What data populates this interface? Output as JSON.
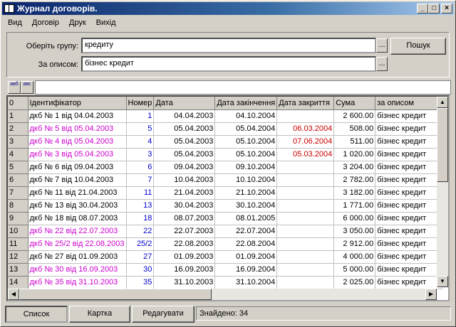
{
  "title": "Журнал договорів.",
  "menu": [
    "Вид",
    "Договір",
    "Друк",
    "Вихід"
  ],
  "filters": {
    "group_label": "Оберіть групу:",
    "group_value": "кредиту",
    "desc_label": "За описом:",
    "desc_value": "бізнес кредит",
    "dots": "...",
    "search_label": "Пошук"
  },
  "toolbar": {
    "sort_icon_text": "авб",
    "filter_icon_text": "авс"
  },
  "columns": [
    "0",
    "Ідентифікатор",
    "Номер",
    "Дата",
    "Дата закінчення",
    "Дата закриття",
    "Сума",
    "за описом"
  ],
  "colors": {
    "pink": "#cc00cc",
    "blue": "#0000cc",
    "red": "#cc0000"
  },
  "rows": [
    {
      "n": "1",
      "id": "дкб № 1 від 04.04.2003",
      "num": "1",
      "date": "04.04.2003",
      "end": "04.10.2004",
      "closed": "",
      "sum": "2 600.00",
      "desc": "бізнес кредит",
      "pink": false
    },
    {
      "n": "2",
      "id": "дкб № 5 від 05.04.2003",
      "num": "5",
      "date": "05.04.2003",
      "end": "05.04.2004",
      "closed": "06.03.2004",
      "sum": "508.00",
      "desc": "бізнес кредит",
      "pink": true
    },
    {
      "n": "3",
      "id": "дкб № 4 від 05.04.2003",
      "num": "4",
      "date": "05.04.2003",
      "end": "05.10.2004",
      "closed": "07.06.2004",
      "sum": "511.00",
      "desc": "бізнес кредит",
      "pink": true
    },
    {
      "n": "4",
      "id": "дкб № 3 від 05.04.2003",
      "num": "3",
      "date": "05.04.2003",
      "end": "05.10.2004",
      "closed": "05.03.2004",
      "sum": "1 020.00",
      "desc": "бізнес кредит",
      "pink": true
    },
    {
      "n": "5",
      "id": "дкб № 6 від 09.04.2003",
      "num": "6",
      "date": "09.04.2003",
      "end": "09.10.2004",
      "closed": "",
      "sum": "3 204.00",
      "desc": "бізнес кредит",
      "pink": false
    },
    {
      "n": "6",
      "id": "дкб № 7 від 10.04.2003",
      "num": "7",
      "date": "10.04.2003",
      "end": "10.10.2004",
      "closed": "",
      "sum": "2 782.00",
      "desc": "бізнес кредит",
      "pink": false
    },
    {
      "n": "7",
      "id": "дкб № 11 від 21.04.2003",
      "num": "11",
      "date": "21.04.2003",
      "end": "21.10.2004",
      "closed": "",
      "sum": "3 182.00",
      "desc": "бізнес кредит",
      "pink": false
    },
    {
      "n": "8",
      "id": "дкб № 13 від 30.04.2003",
      "num": "13",
      "date": "30.04.2003",
      "end": "30.10.2004",
      "closed": "",
      "sum": "1 771.00",
      "desc": "бізнес кредит",
      "pink": false
    },
    {
      "n": "9",
      "id": "дкб № 18 від 08.07.2003",
      "num": "18",
      "date": "08.07.2003",
      "end": "08.01.2005",
      "closed": "",
      "sum": "6 000.00",
      "desc": "бізнес кредит",
      "pink": false
    },
    {
      "n": "10",
      "id": "дкб № 22 від 22.07.2003",
      "num": "22",
      "date": "22.07.2003",
      "end": "22.07.2004",
      "closed": "",
      "sum": "3 050.00",
      "desc": "бізнес кредит",
      "pink": true
    },
    {
      "n": "11",
      "id": "дкб № 25/2 від 22.08.2003",
      "num": "25/2",
      "date": "22.08.2003",
      "end": "22.08.2004",
      "closed": "",
      "sum": "2 912.00",
      "desc": "бізнес кредит",
      "pink": true
    },
    {
      "n": "12",
      "id": "дкб № 27 від 01.09.2003",
      "num": "27",
      "date": "01.09.2003",
      "end": "01.09.2004",
      "closed": "",
      "sum": "4 000.00",
      "desc": "бізнес кредит",
      "pink": false
    },
    {
      "n": "13",
      "id": "дкб № 30 від 16.09.2003",
      "num": "30",
      "date": "16.09.2003",
      "end": "16.09.2004",
      "closed": "",
      "sum": "5 000.00",
      "desc": "бізнес кредит",
      "pink": true
    },
    {
      "n": "14",
      "id": "дкб № 35 від 31.10.2003",
      "num": "35",
      "date": "31.10.2003",
      "end": "31.10.2004",
      "closed": "",
      "sum": "2 025.00",
      "desc": "бізнес кредит",
      "pink": true
    }
  ],
  "bottom": {
    "list_label": "Список",
    "card_label": "Картка",
    "edit_label": "Редагувати",
    "status": "Знайдено: 34"
  }
}
